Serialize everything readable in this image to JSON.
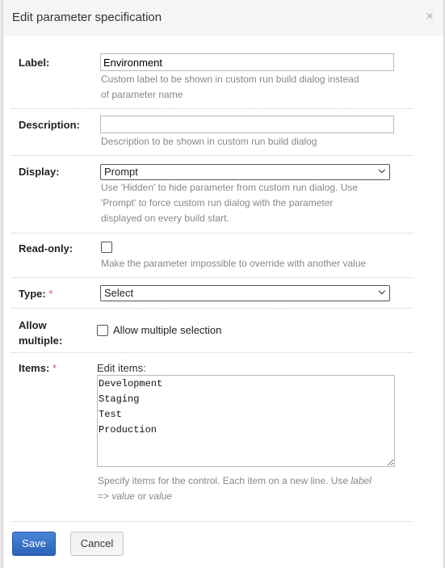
{
  "dialog": {
    "title": "Edit parameter specification",
    "close_icon": "×"
  },
  "label": {
    "label": "Label:",
    "value": "Environment",
    "hint1": "Custom label to be shown in custom run build dialog instead",
    "hint2": "of parameter name"
  },
  "description": {
    "label": "Description:",
    "value": "",
    "hint": "Description to be shown in custom run build dialog"
  },
  "display": {
    "label": "Display:",
    "selected": "Prompt",
    "hint1": "Use 'Hidden' to hide parameter from custom run dialog. Use",
    "hint2": "'Prompt' to force custom run dialog with the parameter",
    "hint3": "displayed on every build start."
  },
  "readonly": {
    "label": "Read-only:",
    "checked": false,
    "hint": "Make the parameter impossible to override with another value"
  },
  "type": {
    "label": "Type:",
    "required": "*",
    "selected": "Select"
  },
  "allow_multiple": {
    "label1": "Allow",
    "label2": "multiple:",
    "checkbox_label": "Allow multiple selection",
    "checked": false
  },
  "items": {
    "label": "Items:",
    "required": "*",
    "edit_label": "Edit items:",
    "value": "Development\nStaging\nTest\nProduction",
    "hint_text": "Specify items for the control. Each item on a new line. Use ",
    "hint_label": "label",
    "hint_arrow": "=> ",
    "hint_value1": "value",
    "hint_or": " or ",
    "hint_value2": "value"
  },
  "buttons": {
    "save": "Save",
    "cancel": "Cancel"
  }
}
